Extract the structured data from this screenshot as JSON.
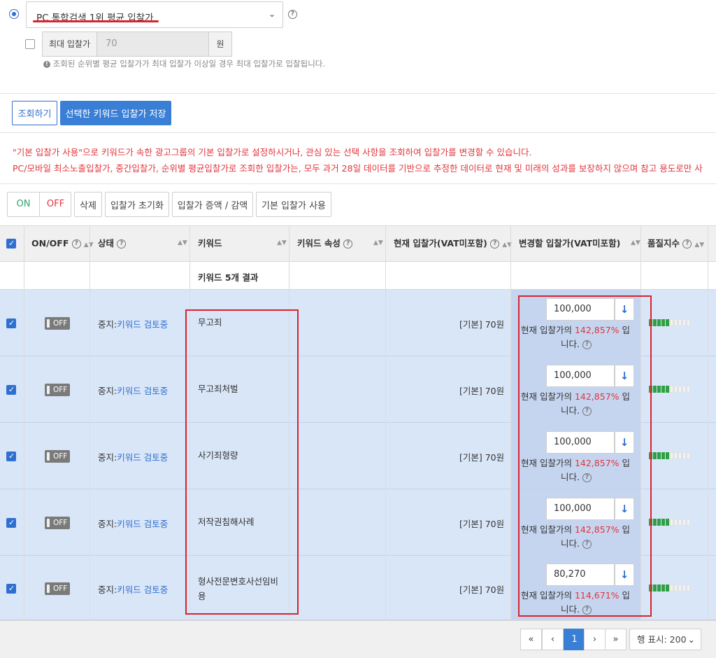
{
  "bid_settings": {
    "strategy_select_value": "PC 통합검색 1위 평균 입찰가",
    "max_bid_label": "최대 입찰가",
    "max_bid_value": "70",
    "max_bid_unit": "원",
    "note": "조회된 순위별 평균 입찰가가 최대 입찰가 이상일 경우 최대 입찰가로 입찰됩니다."
  },
  "actions": {
    "lookup_button": "조회하기",
    "save_button": "선택한 키워드 입찰가 저장"
  },
  "notices": {
    "line1": "\"기본 입찰가 사용\"으로 키워드가 속한 광고그룹의 기본 입찰가로 설정하시거나, 관심 있는 선택 사항을 조회하여 입찰가를 변경할 수 있습니다.",
    "line2": "PC/모바일 최소노출입찰가, 중간입찰가, 순위별 평균입찰가로 조회한 입찰가는, 모두 과거 28일 데이터를 기반으로 추정한 데이터로 현재 및 미래의 성과를 보장하지 않으며 참고 용도로만 사"
  },
  "toolbar": {
    "on": "ON",
    "off": "OFF",
    "delete": "삭제",
    "reset_bid": "입찰가 초기화",
    "adjust_bid": "입찰가 증액 / 감액",
    "use_default_bid": "기본 입찰가 사용"
  },
  "table": {
    "headers": {
      "onoff": "ON/OFF",
      "status": "상태",
      "keyword": "키워드",
      "keyword_attr": "키워드 속성",
      "current_bid": "현재 입찰가(VAT미포함)",
      "new_bid": "변경할 입찰가(VAT미포함)",
      "quality": "품질지수"
    },
    "summary": "키워드 5개 결과",
    "rows": [
      {
        "toggle": "OFF",
        "status_prefix": "중지:",
        "status_link": "키워드 검토중",
        "keyword": "무고죄",
        "current_bid": "[기본] 70원",
        "new_bid": "100,000",
        "note_prefix": "현재 입찰가의 ",
        "note_pct": "142,857%",
        "note_suffix": " 입",
        "note_line2": "니다.",
        "quality_level": 4
      },
      {
        "toggle": "OFF",
        "status_prefix": "중지:",
        "status_link": "키워드 검토중",
        "keyword": "무고죄처벌",
        "current_bid": "[기본] 70원",
        "new_bid": "100,000",
        "note_prefix": "현재 입찰가의 ",
        "note_pct": "142,857%",
        "note_suffix": " 입",
        "note_line2": "니다.",
        "quality_level": 4
      },
      {
        "toggle": "OFF",
        "status_prefix": "중지:",
        "status_link": "키워드 검토중",
        "keyword": "사기죄형량",
        "current_bid": "[기본] 70원",
        "new_bid": "100,000",
        "note_prefix": "현재 입찰가의 ",
        "note_pct": "142,857%",
        "note_suffix": " 입",
        "note_line2": "니다.",
        "quality_level": 4
      },
      {
        "toggle": "OFF",
        "status_prefix": "중지:",
        "status_link": "키워드 검토중",
        "keyword": "저작권침해사례",
        "current_bid": "[기본] 70원",
        "new_bid": "100,000",
        "note_prefix": "현재 입찰가의 ",
        "note_pct": "142,857%",
        "note_suffix": " 입",
        "note_line2": "니다.",
        "quality_level": 4
      },
      {
        "toggle": "OFF",
        "status_prefix": "중지:",
        "status_link": "키워드 검토중",
        "keyword": "형사전문변호사선임비",
        "keyword_line2": "용",
        "current_bid": "[기본] 70원",
        "new_bid": "80,270",
        "note_prefix": "현재 입찰가의 ",
        "note_pct": "114,671%",
        "note_suffix": " 입",
        "note_line2": "니다.",
        "quality_level": 4
      }
    ]
  },
  "pagination": {
    "first": "«",
    "prev": "‹",
    "current": "1",
    "next": "›",
    "last": "»",
    "rows_per_page": "행 표시: 200"
  },
  "icons": {
    "select_chevron": "chevron-down-icon",
    "help": "question-circle-icon",
    "bid_apply": "arrow-down-icon",
    "note": "exclamation-circle-icon"
  },
  "colors": {
    "primary": "#3a7fd6",
    "danger": "#e2353b",
    "success": "#2ea043",
    "row_selected": "#d9e6f8"
  }
}
